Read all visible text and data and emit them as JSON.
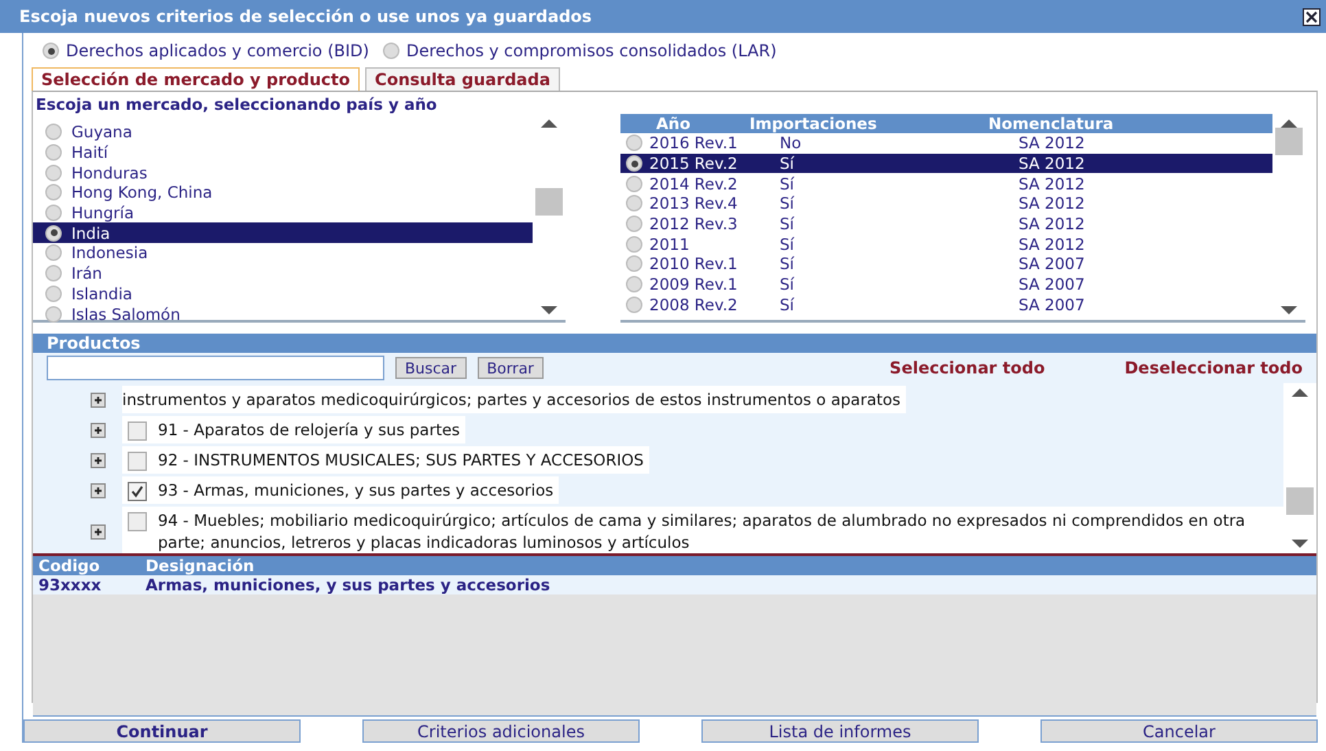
{
  "window": {
    "title": "Escoja nuevos criterios de selección o use unos ya guardados"
  },
  "mode_options": [
    {
      "label": "Derechos aplicados y comercio (BID)",
      "selected": true
    },
    {
      "label": "Derechos y compromisos consolidados (LAR)",
      "selected": false
    }
  ],
  "tabs": [
    {
      "label": "Selección de mercado y producto",
      "selected": true
    },
    {
      "label": "Consulta guardada",
      "selected": false
    }
  ],
  "market": {
    "prompt": "Escoja un mercado, seleccionando país y año",
    "countries": [
      {
        "name": "Guyana",
        "selected": false
      },
      {
        "name": "Haití",
        "selected": false
      },
      {
        "name": "Honduras",
        "selected": false
      },
      {
        "name": "Hong Kong, China",
        "selected": false
      },
      {
        "name": "Hungría",
        "selected": false
      },
      {
        "name": "India",
        "selected": true
      },
      {
        "name": "Indonesia",
        "selected": false
      },
      {
        "name": "Irán",
        "selected": false
      },
      {
        "name": "Islandia",
        "selected": false
      },
      {
        "name": "Islas Salomón",
        "selected": false
      }
    ],
    "years": {
      "columns": [
        "Año",
        "Importaciones",
        "Nomenclatura"
      ],
      "rows": [
        {
          "year": "2016 Rev.1",
          "imports": "No",
          "nomenclature": "SA 2012",
          "selected": false
        },
        {
          "year": "2015 Rev.2",
          "imports": "Sí",
          "nomenclature": "SA 2012",
          "selected": true
        },
        {
          "year": "2014 Rev.2",
          "imports": "Sí",
          "nomenclature": "SA 2012",
          "selected": false
        },
        {
          "year": "2013 Rev.4",
          "imports": "Sí",
          "nomenclature": "SA 2012",
          "selected": false
        },
        {
          "year": "2012 Rev.3",
          "imports": "Sí",
          "nomenclature": "SA 2012",
          "selected": false
        },
        {
          "year": "2011",
          "imports": "Sí",
          "nomenclature": "SA 2012",
          "selected": false
        },
        {
          "year": "2010 Rev.1",
          "imports": "Sí",
          "nomenclature": "SA 2007",
          "selected": false
        },
        {
          "year": "2009 Rev.1",
          "imports": "Sí",
          "nomenclature": "SA 2007",
          "selected": false
        },
        {
          "year": "2008 Rev.2",
          "imports": "Sí",
          "nomenclature": "SA 2007",
          "selected": false
        }
      ]
    }
  },
  "products": {
    "title": "Productos",
    "search_button": "Buscar",
    "clear_button": "Borrar",
    "select_all": "Seleccionar todo",
    "deselect_all": "Deseleccionar todo",
    "items": [
      {
        "text": "instrumentos y aparatos medicoquirúrgicos; partes y accesorios de estos instrumentos o aparatos",
        "kind": "continued"
      },
      {
        "text": "91 - Aparatos de relojería y sus partes",
        "checked": false,
        "kind": "item"
      },
      {
        "text": "92 - INSTRUMENTOS MUSICALES; SUS PARTES Y ACCESORIOS",
        "checked": false,
        "kind": "item"
      },
      {
        "text": "93 - Armas, municiones, y sus partes y accesorios",
        "checked": true,
        "kind": "item"
      },
      {
        "text": "94 - Muebles; mobiliario medicoquirúrgico; artículos de cama y similares; aparatos de alumbrado no expresados ni comprendidos en otra parte; anuncios, letreros y placas indicadoras luminosos y artículos",
        "checked": false,
        "kind": "item"
      }
    ]
  },
  "selection": {
    "columns": [
      "Codigo",
      "Designación"
    ],
    "rows": [
      {
        "code": "93xxxx",
        "designation": "Armas, municiones, y sus partes y accesorios"
      }
    ]
  },
  "buttons": [
    {
      "label": "Continuar",
      "kind": "primary"
    },
    {
      "label": "Criterios adicionales",
      "kind": "normal"
    },
    {
      "label": "Lista de informes",
      "kind": "normal"
    },
    {
      "label": "Cancelar",
      "kind": "normal"
    }
  ]
}
